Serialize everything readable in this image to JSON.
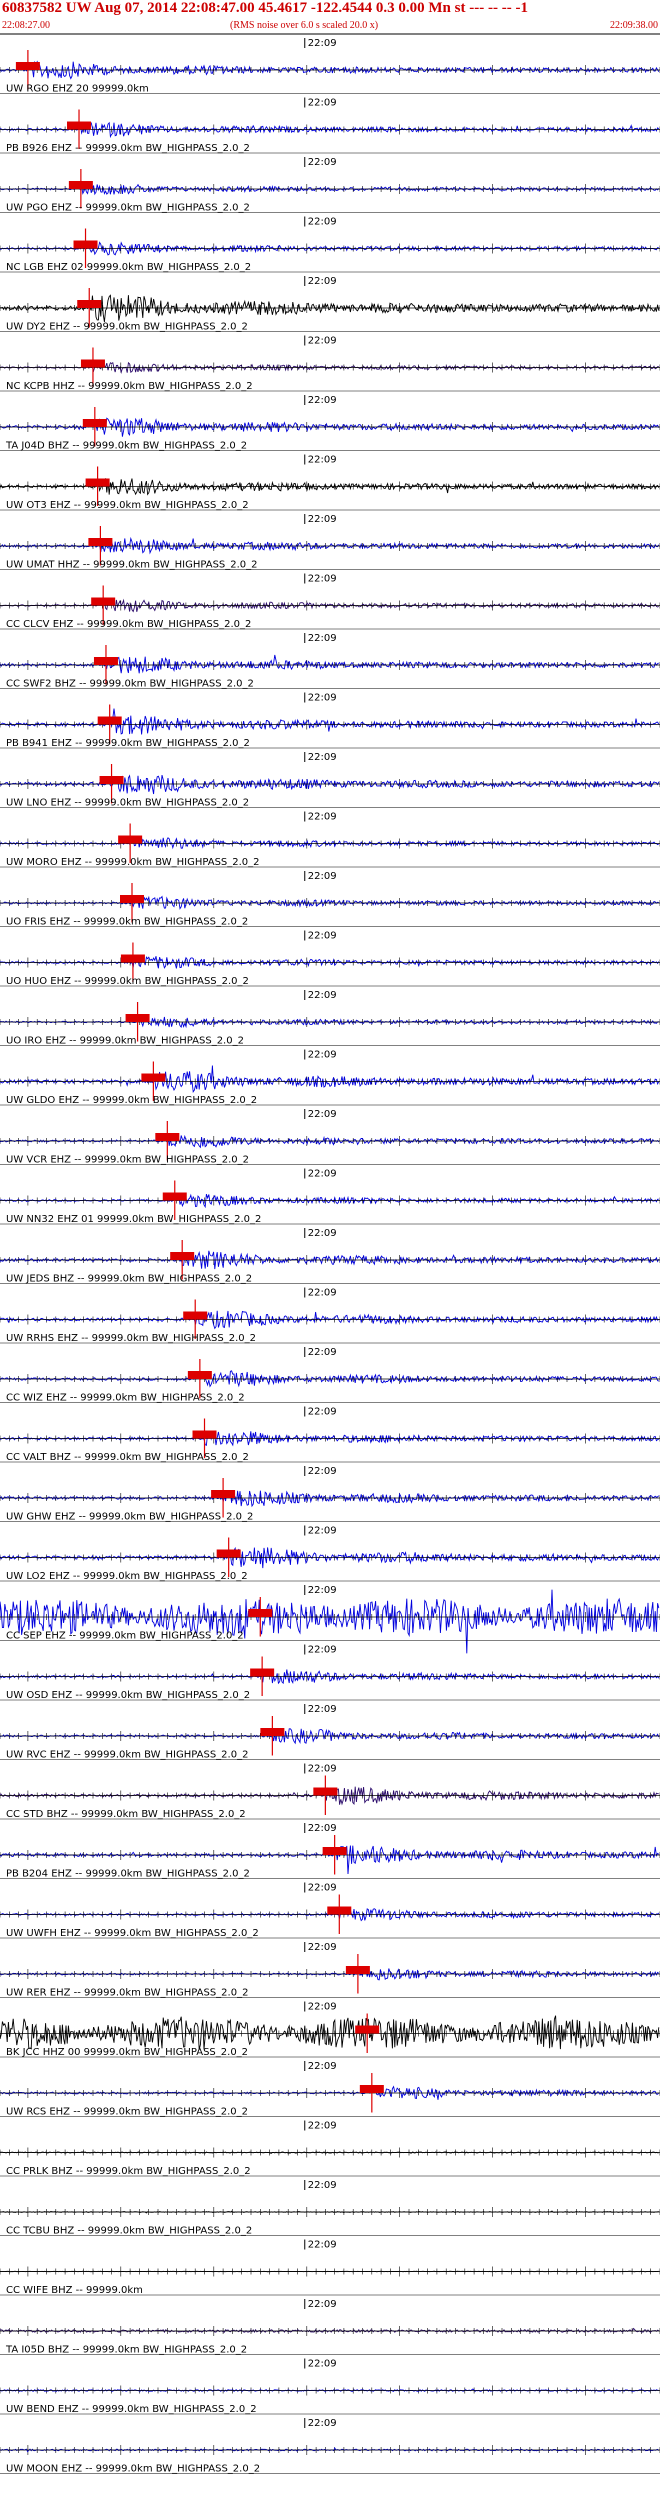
{
  "header": {
    "title": "60837582 UW Aug 07, 2014 22:08:47.00   45.4617 -122.4544   0.3 0.00 Mn st --- -- --  -1",
    "start_time": "22:08:27.00",
    "noise_note": "(RMS noise over 6.0 s scaled 20.0 x)",
    "end_time": "22:09:38.00"
  },
  "chart_data": {
    "type": "line",
    "title": "60837582 UW Aug 07, 2014 22:08:47.00   45.4617 -122.4544   0.3 0.00 Mn st --- -- --  -1",
    "xlim": [
      "22:08:27.00",
      "22:09:38.00"
    ],
    "x_unit": "time (s)",
    "minute_tick_label": "22:09",
    "colors": {
      "trace_blue": "#0000dd",
      "trace_black": "#000000",
      "trace_purple": "#2a0a6a",
      "pick": "#dd0000",
      "label": "#000000"
    },
    "traces": [
      {
        "label": "UW RGO EHZ 20 99999.0km",
        "pick_s": 1.0,
        "style": "blue",
        "amp": 0.5
      },
      {
        "label": "PB B926 EHZ -- 99999.0km BW_HIGHPASS_2.0_2",
        "pick_s": 6.5,
        "style": "blue",
        "amp": 0.4
      },
      {
        "label": "UW PGO EHZ -- 99999.0km BW_HIGHPASS_2.0_2",
        "pick_s": 6.7,
        "style": "blue",
        "amp": 0.3
      },
      {
        "label": "NC LGB EHZ 02 99999.0km BW_HIGHPASS_2.0_2",
        "pick_s": 7.2,
        "style": "blue",
        "amp": 0.35
      },
      {
        "label": "UW DY2 EHZ -- 99999.0km BW_HIGHPASS_2.0_2",
        "pick_s": 7.6,
        "style": "black",
        "amp": 0.8
      },
      {
        "label": "NC KCPB HHZ -- 99999.0km BW_HIGHPASS_2.0_2",
        "pick_s": 8.0,
        "style": "purple",
        "amp": 0.3
      },
      {
        "label": "TA J04D BHZ -- 99999.0km BW_HIGHPASS_2.0_2",
        "pick_s": 8.2,
        "style": "blue",
        "amp": 0.55
      },
      {
        "label": "UW OT3 EHZ -- 99999.0km BW_HIGHPASS_2.0_2",
        "pick_s": 8.5,
        "style": "black",
        "amp": 0.5
      },
      {
        "label": "UW UMAT HHZ -- 99999.0km BW_HIGHPASS_2.0_2",
        "pick_s": 8.8,
        "style": "blue",
        "amp": 0.45
      },
      {
        "label": "CC CLCV EHZ -- 99999.0km BW_HIGHPASS_2.0_2",
        "pick_s": 9.1,
        "style": "purple",
        "amp": 0.35
      },
      {
        "label": "CC SWF2 BHZ -- 99999.0km BW_HIGHPASS_2.0_2",
        "pick_s": 9.4,
        "style": "blue",
        "amp": 0.5
      },
      {
        "label": "PB B941 EHZ -- 99999.0km BW_HIGHPASS_2.0_2",
        "pick_s": 9.8,
        "style": "blue",
        "amp": 0.55
      },
      {
        "label": "UW LNO EHZ -- 99999.0km BW_HIGHPASS_2.0_2",
        "pick_s": 10.0,
        "style": "blue",
        "amp": 0.6
      },
      {
        "label": "UW MORO EHZ -- 99999.0km BW_HIGHPASS_2.0_2",
        "pick_s": 12.0,
        "style": "blue",
        "amp": 0.35
      },
      {
        "label": "UO FRIS EHZ -- 99999.0km BW_HIGHPASS_2.0_2",
        "pick_s": 12.2,
        "style": "blue",
        "amp": 0.35
      },
      {
        "label": "UO HUO EHZ -- 99999.0km BW_HIGHPASS_2.0_2",
        "pick_s": 12.3,
        "style": "blue",
        "amp": 0.35
      },
      {
        "label": "UO IRO EHZ -- 99999.0km BW_HIGHPASS_2.0_2",
        "pick_s": 12.8,
        "style": "blue",
        "amp": 0.3
      },
      {
        "label": "UW GLDO EHZ -- 99999.0km BW_HIGHPASS_2.0_2",
        "pick_s": 14.5,
        "style": "blue",
        "amp": 0.6
      },
      {
        "label": "UW VCR EHZ -- 99999.0km BW_HIGHPASS_2.0_2",
        "pick_s": 16.0,
        "style": "blue",
        "amp": 0.4
      },
      {
        "label": "UW NN32 EHZ 01 99999.0km BW_HIGHPASS_2.0_2",
        "pick_s": 16.8,
        "style": "blue",
        "amp": 0.35
      },
      {
        "label": "UW JEDS BHZ -- 99999.0km BW_HIGHPASS_2.0_2",
        "pick_s": 17.6,
        "style": "blue",
        "amp": 0.5
      },
      {
        "label": "UW RRHS EHZ -- 99999.0km BW_HIGHPASS_2.0_2",
        "pick_s": 19.0,
        "style": "blue",
        "amp": 0.5
      },
      {
        "label": "CC WIZ EHZ -- 99999.0km BW_HIGHPASS_2.0_2",
        "pick_s": 19.5,
        "style": "blue",
        "amp": 0.45
      },
      {
        "label": "CC VALT BHZ -- 99999.0km BW_HIGHPASS_2.0_2",
        "pick_s": 20.0,
        "style": "blue",
        "amp": 0.45
      },
      {
        "label": "UW GHW EHZ -- 99999.0km BW_HIGHPASS_2.0_2",
        "pick_s": 22.0,
        "style": "blue",
        "amp": 0.5
      },
      {
        "label": "UW LO2 EHZ -- 99999.0km BW_HIGHPASS_2.0_2",
        "pick_s": 22.6,
        "style": "blue",
        "amp": 0.6
      },
      {
        "label": "CC SEP EHZ -- 99999.0km BW_HIGHPASS_2.0_2",
        "pick_s": 26.0,
        "style": "blue",
        "amp": 0.95
      },
      {
        "label": "UW OSD EHZ -- 99999.0km BW_HIGHPASS_2.0_2",
        "pick_s": 26.2,
        "style": "blue",
        "amp": 0.4
      },
      {
        "label": "UW RVC EHZ -- 99999.0km BW_HIGHPASS_2.0_2",
        "pick_s": 27.3,
        "style": "blue",
        "amp": 0.4
      },
      {
        "label": "CC STD BHZ -- 99999.0km BW_HIGHPASS_2.0_2",
        "pick_s": 33.0,
        "style": "purple",
        "amp": 0.5
      },
      {
        "label": "PB B204 EHZ -- 99999.0km BW_HIGHPASS_2.0_2",
        "pick_s": 34.0,
        "style": "blue",
        "amp": 0.55
      },
      {
        "label": "UW UWFH EHZ -- 99999.0km BW_HIGHPASS_2.0_2",
        "pick_s": 34.5,
        "style": "blue",
        "amp": 0.35
      },
      {
        "label": "UW RER EHZ -- 99999.0km BW_HIGHPASS_2.0_2",
        "pick_s": 36.5,
        "style": "blue",
        "amp": 0.35
      },
      {
        "label": "BK JCC HHZ 00 99999.0km BW_HIGHPASS_2.0_2",
        "pick_s": 37.5,
        "style": "black",
        "amp": 0.85
      },
      {
        "label": "UW RCS EHZ -- 99999.0km BW_HIGHPASS_2.0_2",
        "pick_s": 38.0,
        "style": "blue",
        "amp": 0.35
      },
      {
        "label": "CC PRLK BHZ -- 99999.0km BW_HIGHPASS_2.0_2",
        "pick_s": null,
        "style": "black",
        "amp": 0.2
      },
      {
        "label": "CC TCBU BHZ -- 99999.0km BW_HIGHPASS_2.0_2",
        "pick_s": null,
        "style": "black",
        "amp": 0.15
      },
      {
        "label": "CC WIFE BHZ -- 99999.0km",
        "pick_s": null,
        "style": "black",
        "amp": 0.1
      },
      {
        "label": "TA I05D BHZ -- 99999.0km BW_HIGHPASS_2.0_2",
        "pick_s": null,
        "style": "purple",
        "amp": 0.45
      },
      {
        "label": "UW BEND EHZ -- 99999.0km BW_HIGHPASS_2.0_2",
        "pick_s": null,
        "style": "blue",
        "amp": 0.3
      },
      {
        "label": "UW MOON EHZ -- 99999.0km BW_HIGHPASS_2.0_2",
        "pick_s": null,
        "style": "blue",
        "amp": 0.3
      }
    ]
  }
}
